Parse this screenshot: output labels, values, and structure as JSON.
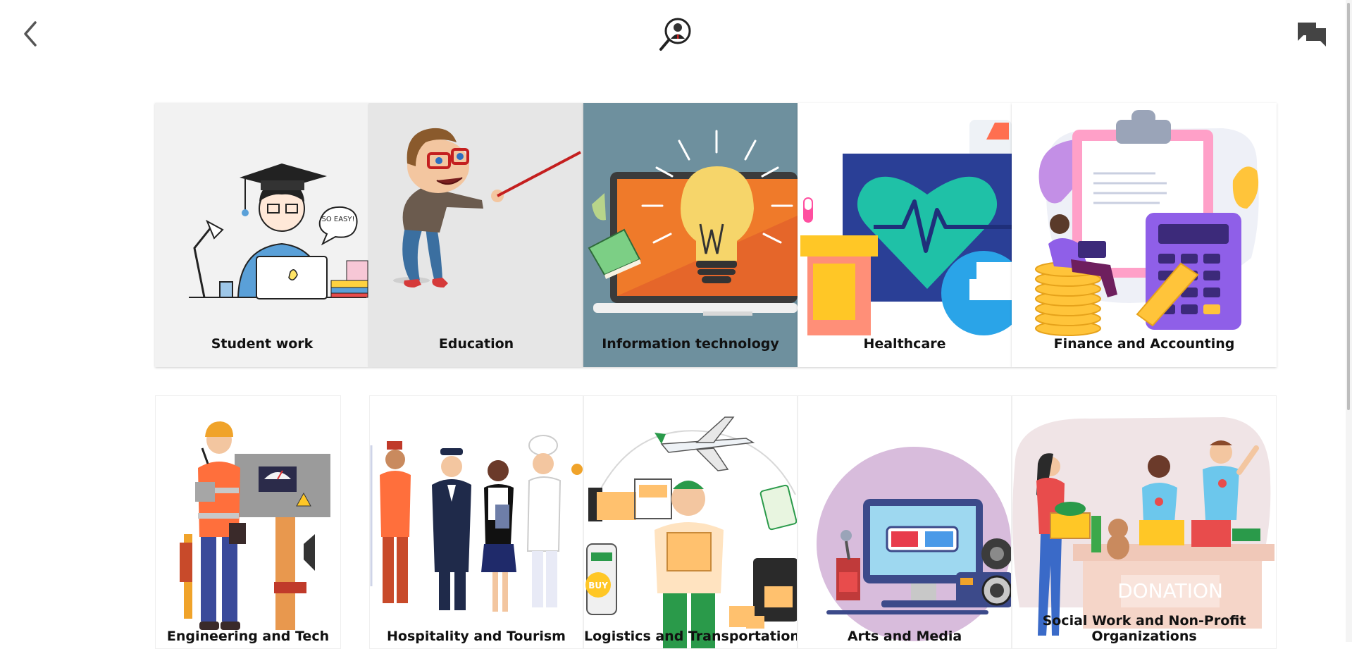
{
  "header": {
    "back_icon": "chevron-left-icon",
    "logo_icon": "magnifier-person-logo",
    "chat_icon": "chat-bubbles-icon"
  },
  "categories": [
    {
      "label": "Student work",
      "bg": "#f2f2f2"
    },
    {
      "label": "Education",
      "bg": "#e6e6e6"
    },
    {
      "label": "Information technology",
      "bg": "#6e909e"
    },
    {
      "label": "Healthcare",
      "bg": "#ffffff"
    },
    {
      "label": "Finance and Accounting",
      "bg": "#ffffff"
    },
    {
      "label": "Engineering and Tech",
      "bg": "#ffffff"
    },
    {
      "label": "Hospitality and Tourism",
      "bg": "#ffffff"
    },
    {
      "label": "Logistics and Transportation",
      "bg": "#ffffff"
    },
    {
      "label": "Arts and Media",
      "bg": "#ffffff"
    },
    {
      "label": "Social Work and Non-Profit Organizations",
      "bg": "#ffffff"
    }
  ],
  "art_text": {
    "speech_bubble": "SO EASY!",
    "buy_badge": "BUY",
    "donation_box": "DONATION"
  }
}
